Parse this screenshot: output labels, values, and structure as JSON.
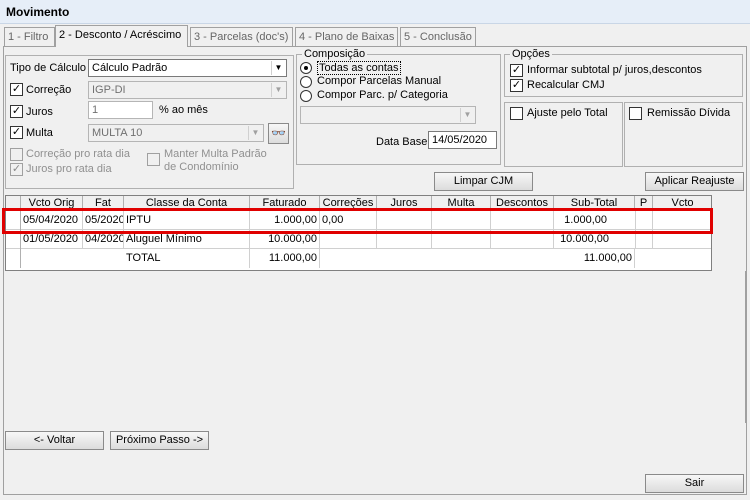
{
  "window": {
    "title": "Movimento"
  },
  "tabs": [
    {
      "label": "1 - Filtro",
      "active": false
    },
    {
      "label": "2 - Desconto / Acréscimo",
      "active": true
    },
    {
      "label": "3 - Parcelas (doc's)",
      "active": false
    },
    {
      "label": "4 - Plano de Baixas",
      "active": false
    },
    {
      "label": "5 - Conclusão",
      "active": false
    }
  ],
  "calc": {
    "tipo_label": "Tipo de Cálculo",
    "tipo_value": "Cálculo Padrão",
    "correcao_label": "Correção",
    "correcao_value": "IGP-DI",
    "juros_label": "Juros",
    "juros_value": "1",
    "juros_unit": "% ao mês",
    "multa_label": "Multa",
    "multa_value": "MULTA 10",
    "correcao_pro_rata": "Correção pro rata dia",
    "juros_pro_rata": "Juros pro rata dia",
    "manter_multa": "Manter Multa Padrão de Condomínio"
  },
  "composicao": {
    "title": "Composição",
    "options": [
      "Todas as contas",
      "Compor Parcelas Manual",
      "Compor Parc. p/ Categoria"
    ],
    "selected": "Todas as contas",
    "data_base_label": "Data Base",
    "data_base_value": "14/05/2020"
  },
  "opcoes": {
    "title": "Opções",
    "informar": "Informar subtotal p/ juros,descontos",
    "recalcular": "Recalcular CMJ",
    "ajuste": "Ajuste pelo Total",
    "remissao": "Remissão Dívida"
  },
  "buttons": {
    "limpar": "Limpar CJM",
    "aplicar": "Aplicar Reajuste",
    "voltar": "<- Voltar",
    "proximo": "Próximo Passo ->",
    "sair": "Sair"
  },
  "grid": {
    "columns": [
      "Vcto Orig",
      "Fat",
      "Classe da Conta",
      "Faturado",
      "Correções",
      "Juros",
      "Multa",
      "Descontos",
      "Sub-Total",
      "P",
      "Vcto"
    ],
    "rows": [
      {
        "vcto_orig": "05/04/2020",
        "fat": "05/2020",
        "classe": "IPTU",
        "faturado": "1.000,00",
        "correcoes": "0,00",
        "subtotal": "1.000,00"
      },
      {
        "vcto_orig": "01/05/2020",
        "fat": "04/2020",
        "classe": "Aluguel Mínimo",
        "faturado": "10.000,00",
        "correcoes": "",
        "subtotal": "10.000,00"
      }
    ],
    "total": {
      "label": "TOTAL",
      "faturado": "11.000,00",
      "subtotal": "11.000,00"
    }
  }
}
